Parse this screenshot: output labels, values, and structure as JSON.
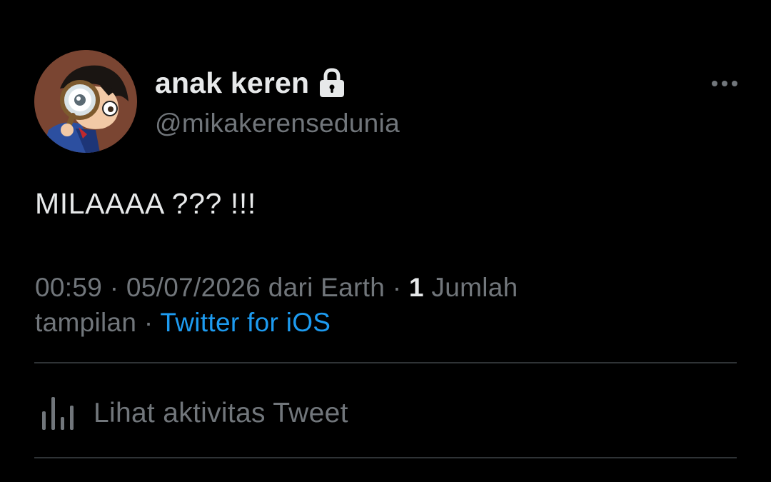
{
  "tweet": {
    "display_name": "anak keren",
    "handle": "@mikakerensedunia",
    "text": "MILAAAA ??? !!!",
    "time": "00:59",
    "date": "05/07/2026",
    "location": "dari Earth",
    "views_count": "1",
    "views_label_part1": "Jumlah",
    "views_label_part2": "tampilan",
    "separator": "·",
    "source": "Twitter for iOS"
  },
  "activity": {
    "label": "Lihat aktivitas Tweet"
  },
  "icons": {
    "avatar": "avatar-image",
    "lock": "lock-icon",
    "more": "more-options-icon",
    "activity": "bar-chart-icon"
  },
  "colors": {
    "background": "#000000",
    "primary_text": "#e7e9ea",
    "secondary_text": "#71767b",
    "link": "#1d9bf0",
    "divider": "#2f3336"
  }
}
